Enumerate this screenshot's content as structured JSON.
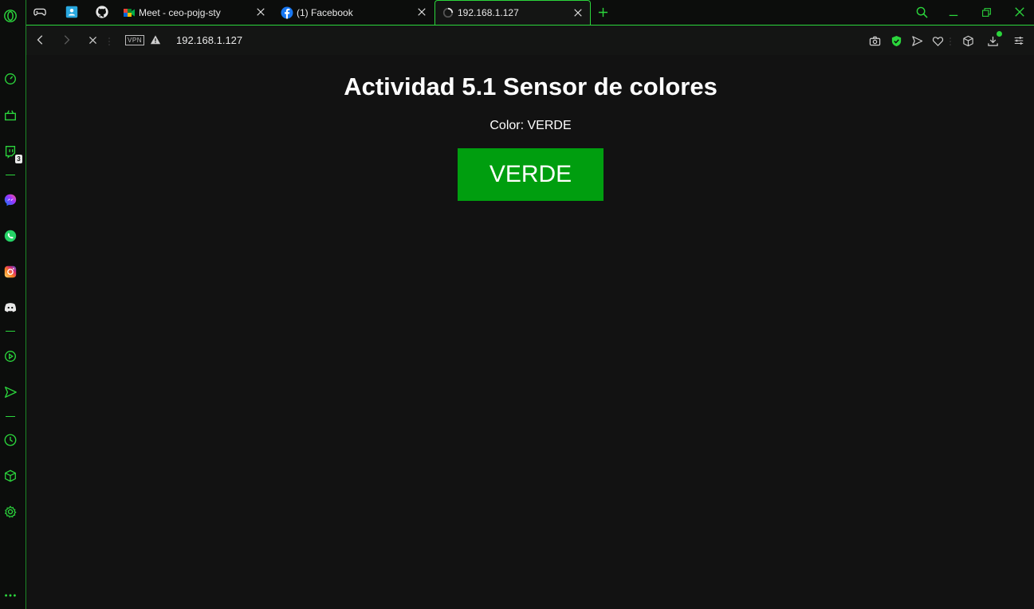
{
  "browser": {
    "accent": "#2bd63c",
    "tabs": [
      {
        "title": "Meet - ceo-pojg-sty",
        "icon": "google-meet-icon"
      },
      {
        "title": "(1) Facebook",
        "icon": "facebook-icon"
      },
      {
        "title": "192.168.1.127",
        "icon": "loading-spinner-icon",
        "active": true
      }
    ],
    "address": {
      "vpn_label": "VPN",
      "url": "192.168.1.127"
    },
    "sidebar": {
      "twitch_badge": "3"
    }
  },
  "page": {
    "title": "Actividad 5.1 Sensor de colores",
    "color_line": "Color: VERDE",
    "color_box_label": "VERDE",
    "color_box_color": "#009e0f"
  }
}
